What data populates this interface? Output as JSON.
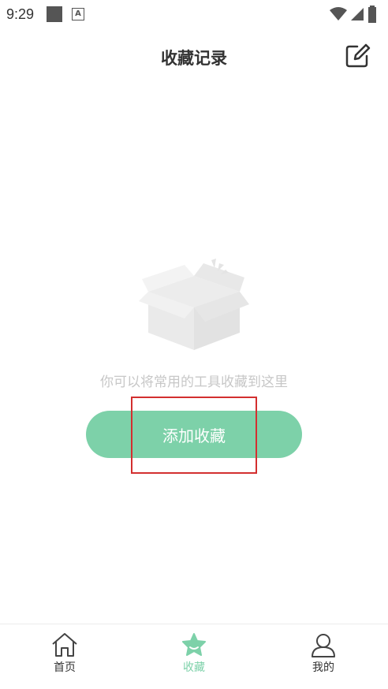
{
  "status_bar": {
    "time": "9:29"
  },
  "header": {
    "title": "收藏记录"
  },
  "empty_state": {
    "message": "你可以将常用的工具收藏到这里"
  },
  "add_button": {
    "label": "添加收藏"
  },
  "tabbar": {
    "items": [
      {
        "label": "首页",
        "icon": "home-icon",
        "active": false
      },
      {
        "label": "收藏",
        "icon": "star-icon",
        "active": true
      },
      {
        "label": "我的",
        "icon": "user-icon",
        "active": false
      }
    ]
  },
  "colors": {
    "accent": "#7dd1a9",
    "highlight": "#d32f2f"
  }
}
